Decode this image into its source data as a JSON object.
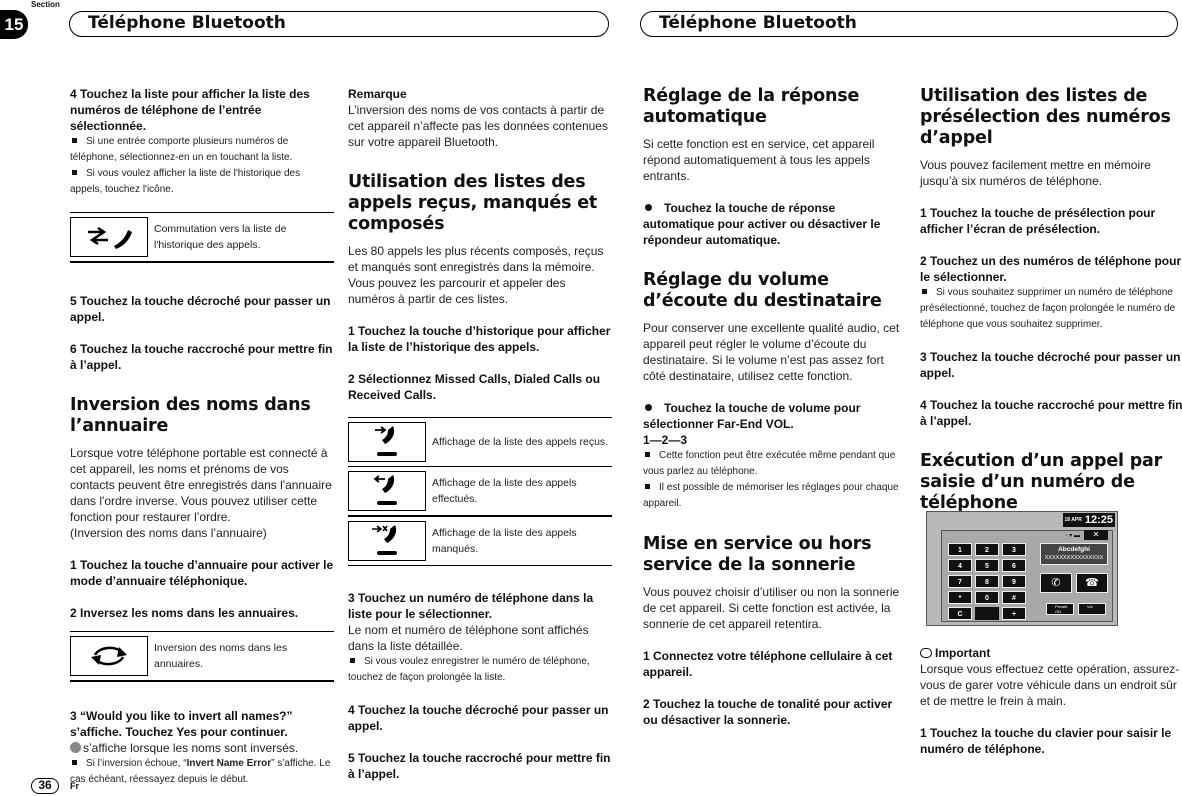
{
  "header": {
    "section_label": "Section",
    "section_number": "15",
    "title_left": "Téléphone Bluetooth",
    "title_right": "Téléphone Bluetooth"
  },
  "footer": {
    "page_number": "36",
    "language": "Fr"
  },
  "col1": {
    "step4": "4    Touchez la liste pour afficher la liste des numéros de téléphone de l’entrée sélectionnée.",
    "step4_notes": [
      "Si une entrée comporte plusieurs numéros de téléphone, sélectionnez-en un en touchant la liste.",
      "Si vous voulez afficher la liste de l'historique des appels, touchez l'icône."
    ],
    "icon_table": [
      {
        "icon": "switch-history-icon",
        "desc": "Commutation vers la liste de l'historique des appels."
      }
    ],
    "step5": "5    Touchez la touche décroché pour passer un appel.",
    "step6": "6    Touchez la touche raccroché pour mettre fin à l’appel.",
    "section_title": "Inversion des noms dans l’annuaire",
    "section_body": "Lorsque votre téléphone portable est connecté à cet appareil, les noms et prénoms de vos contacts peuvent être enregistrés dans l'annuaire dans l'ordre inverse. Vous pouvez utiliser cette fonction pour restaurer l’ordre.",
    "section_body2": "(Inversion des noms dans l’annuaire)",
    "s1": "1    Touchez la touche d’annuaire pour activer le mode d’annuaire téléphonique.",
    "s2": "2    Inversez les noms dans les annuaires.",
    "invert_table": [
      {
        "icon": "invert-names-icon",
        "desc": "Inversion des noms dans les annuaires."
      }
    ],
    "s3": "3    “Would you like to invert all names?” s’affiche. Touchez Yes pour continuer.",
    "s3_body": "s’affiche lorsque les noms sont inversés.",
    "s3_note_pre": "Si l’inversion échoue, “",
    "s3_note_bold": "Invert Name Error",
    "s3_note_post": "” s’affiche. Le cas échéant, réessayez depuis le début."
  },
  "col2": {
    "remark_title": "Remarque",
    "remark_body": "L’inversion des noms de vos contacts à partir de cet appareil n’affecte pas les données contenues sur votre appareil Bluetooth.",
    "section_title": "Utilisation des listes des appels reçus, manqués et composés",
    "section_body": "Les 80 appels les plus récents composés, reçus et manqués sont enregistrés dans la mémoire. Vous pouvez les parcourir et appeler des numéros à partir de ces listes.",
    "s1": "1    Touchez la touche d’historique pour afficher la liste de l’historique des appels.",
    "s2": "2    Sélectionnez Missed Calls, Dialed Calls ou Received Calls.",
    "call_table": [
      {
        "icon": "received-calls-icon",
        "desc": "Affichage de la liste des appels reçus."
      },
      {
        "icon": "dialed-calls-icon",
        "desc": "Affichage de la liste des appels effectués."
      },
      {
        "icon": "missed-calls-icon",
        "desc": "Affichage de la liste des appels manqués."
      }
    ],
    "s3": "3    Touchez un numéro de téléphone dans la liste pour le sélectionner.",
    "s3_body": "Le nom et numéro de téléphone sont affichés dans la liste détaillée.",
    "s3_note": "Si vous voulez enregistrer le numéro de téléphone, touchez de façon prolongée la liste.",
    "s4": "4    Touchez la touche décroché pour passer un appel.",
    "s5": "5    Touchez la touche raccroché pour mettre fin à l’appel."
  },
  "col3": {
    "auto_title": "Réglage de la réponse automatique",
    "auto_body": "Si cette fonction est en service, cet appareil répond automatiquement à tous les appels entrants.",
    "auto_step": "Touchez la touche de réponse automatique pour activer ou désactiver le répondeur automatique.",
    "vol_title": "Réglage du volume d’écoute du destinataire",
    "vol_body": "Pour conserver une excellente qualité audio, cet appareil peut régler le volume d’écoute du destinataire. Si le volume n’est pas assez fort côté destinataire, utilisez cette fonction.",
    "vol_step": "Touchez la touche de volume pour sélectionner Far-End VOL.",
    "vol_seq": "1—2—3",
    "vol_notes": [
      "Cette fonction peut être exécutée même pendant que vous parlez au téléphone.",
      "Il est possible de mémoriser les réglages pour chaque appareil."
    ],
    "ring_title": "Mise en service ou hors service de la sonnerie",
    "ring_body": "Vous pouvez choisir d’utiliser ou non la sonnerie de cet appareil. Si cette fonction est activée, la sonnerie de cet appareil retentira.",
    "ring_s1": "1    Connectez votre téléphone cellulaire à cet appareil.",
    "ring_s2": "2    Touchez la touche de tonalité pour activer ou désactiver la sonnerie."
  },
  "col4": {
    "preset_title": "Utilisation des listes de présélection des numéros d’appel",
    "preset_body": "Vous pouvez facilement mettre en mémoire jusqu’à six numéros de téléphone.",
    "s1": "1    Touchez la touche de présélection pour afficher l’écran de présélection.",
    "s2": "2    Touchez un des numéros de téléphone pour le sélectionner.",
    "s2_note": "Si vous souhaitez supprimer un numéro de téléphone présélectionné, touchez de façon prolongée le numéro de téléphone que vous souhaitez supprimer.",
    "s3": "3    Touchez la touche décroché pour passer un appel.",
    "s4": "4    Touchez la touche raccroché pour mettre fin à l’appel.",
    "dial_title": "Exécution d’un appel par saisie d’un numéro de téléphone",
    "important_label": "Important",
    "important_body": "Lorsque vous effectuez cette opération, assurez-vous de garer votre véhicule dans un endroit sûr et de mettre le frein à main.",
    "d1": "1    Touchez la touche du clavier pour saisir le numéro de téléphone."
  },
  "screen": {
    "date": "18 APR",
    "time": "12:25",
    "close": "✕",
    "keys": [
      "1",
      "2",
      "3",
      "4",
      "5",
      "6",
      "7",
      "8",
      "9",
      "*",
      "0",
      "#",
      "C",
      "",
      "+"
    ],
    "contact_name": "Abcdefghi",
    "contact_number": "XXXXXXXXXXXXXXXX",
    "privacy": "Private ON",
    "vol": "Vol"
  }
}
